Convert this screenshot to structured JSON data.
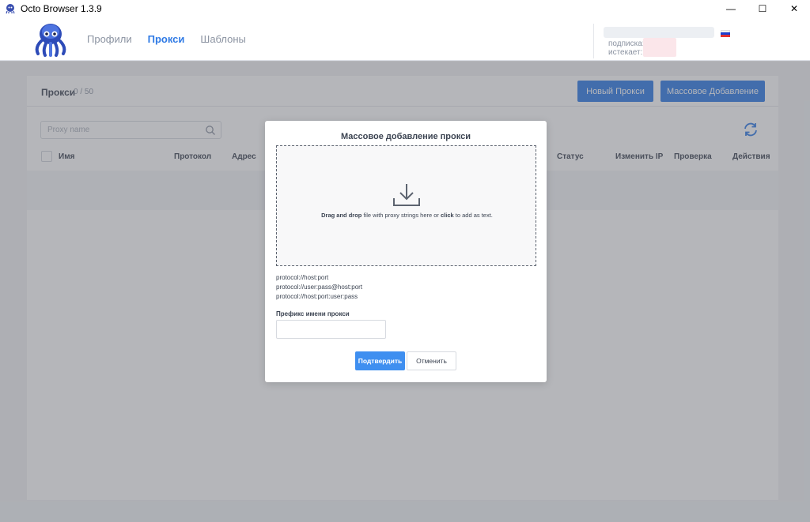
{
  "window": {
    "title": "Octo Browser 1.3.9",
    "controls": {
      "minimize": "—",
      "maximize": "☐",
      "close": "✕"
    }
  },
  "header": {
    "nav": [
      {
        "label": "Профили",
        "active": false
      },
      {
        "label": "Прокси",
        "active": true
      },
      {
        "label": "Шаблоны",
        "active": false
      }
    ],
    "account": {
      "subscription_label": "подписка:",
      "expires_label": "истекает:",
      "language_flag": "russia-flag-icon"
    }
  },
  "page": {
    "title": "Прокси",
    "count": "0 / 50",
    "new_proxy_button": "Новый Прокси",
    "bulk_add_button": "Массовое Добавление",
    "search_placeholder": "Proxy name",
    "columns": [
      "Имя",
      "Протокол",
      "Адрес",
      "Статус",
      "Изменить IP",
      "Проверка",
      "Действия"
    ]
  },
  "modal": {
    "title": "Массовое добавление прокси",
    "drop_bold_1": "Drag and drop",
    "drop_text_1": " file with proxy strings here or ",
    "drop_bold_2": "click",
    "drop_text_2": " to add as text.",
    "formats": [
      "protocol://host:port",
      "protocol://user:pass@host:port",
      "protocol://host:port:user:pass"
    ],
    "prefix_label": "Префикс имени прокси",
    "prefix_value": "",
    "confirm_button": "Подтвердить",
    "cancel_button": "Отменить"
  },
  "colors": {
    "accent": "#2f7ae5",
    "confirm": "#3f8ff0",
    "overlay": "#5a5e66"
  }
}
